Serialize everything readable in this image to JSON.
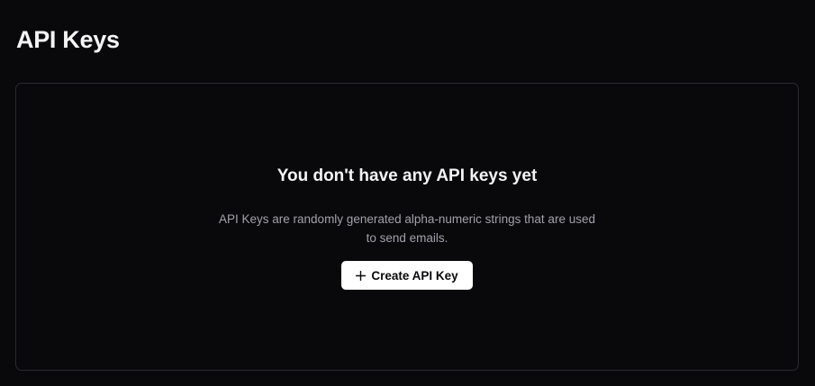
{
  "header": {
    "title": "API Keys"
  },
  "empty_state": {
    "heading": "You don't have any API keys yet",
    "description": "API Keys are randomly generated alpha-numeric strings that are used to send emails.",
    "create_button_label": "Create API Key",
    "create_button_icon": "plus-icon"
  },
  "colors": {
    "background": "#09090c",
    "card_border": "#2a2a30",
    "button_bg": "#ffffff",
    "muted_text": "#a1a1aa"
  }
}
